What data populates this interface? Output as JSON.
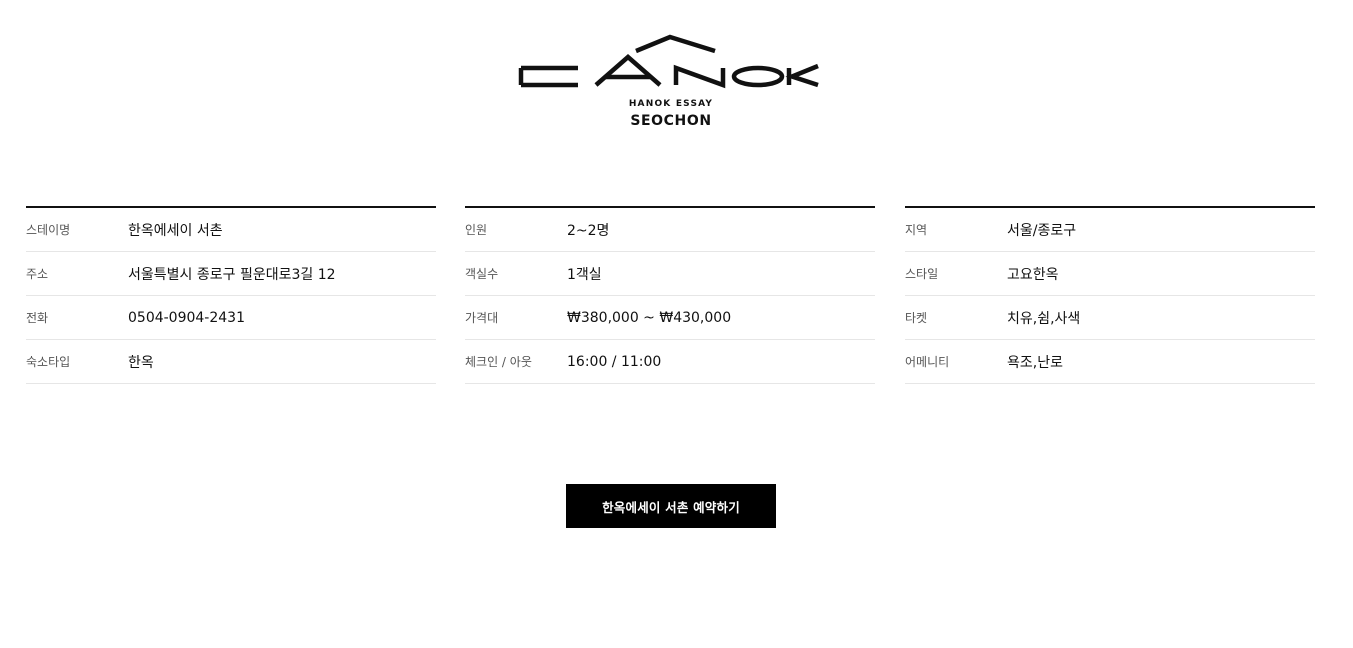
{
  "brand": {
    "logo_word": "HANOK",
    "subtitle": "HANOK ESSAY",
    "location": "SEOCHON"
  },
  "info_columns": [
    {
      "rows": [
        {
          "label": "스테이명",
          "value": "한옥에세이 서촌"
        },
        {
          "label": "주소",
          "value": "서울특별시 종로구 필운대로3길 12"
        },
        {
          "label": "전화",
          "value": "0504-0904-2431"
        },
        {
          "label": "숙소타입",
          "value": "한옥"
        }
      ]
    },
    {
      "rows": [
        {
          "label": "인원",
          "value": "2~2명"
        },
        {
          "label": "객실수",
          "value": "1객실"
        },
        {
          "label": "가격대",
          "value": "₩380,000 ~ ₩430,000"
        },
        {
          "label": "체크인 / 아웃",
          "value": "16:00 / 11:00"
        }
      ]
    },
    {
      "rows": [
        {
          "label": "지역",
          "value": "서울/종로구"
        },
        {
          "label": "스타일",
          "value": "고요한옥"
        },
        {
          "label": "타켓",
          "value": "치유,쉼,사색"
        },
        {
          "label": "어메니티",
          "value": "욕조,난로"
        }
      ]
    }
  ],
  "reserve_button": {
    "label": "한옥에세이 서촌 예약하기"
  },
  "colors": {
    "background": "#ffffff",
    "text": "#111111",
    "label_text": "#555555",
    "divider": "#e6e6e6",
    "button_bg": "#000000",
    "button_text": "#ffffff"
  }
}
